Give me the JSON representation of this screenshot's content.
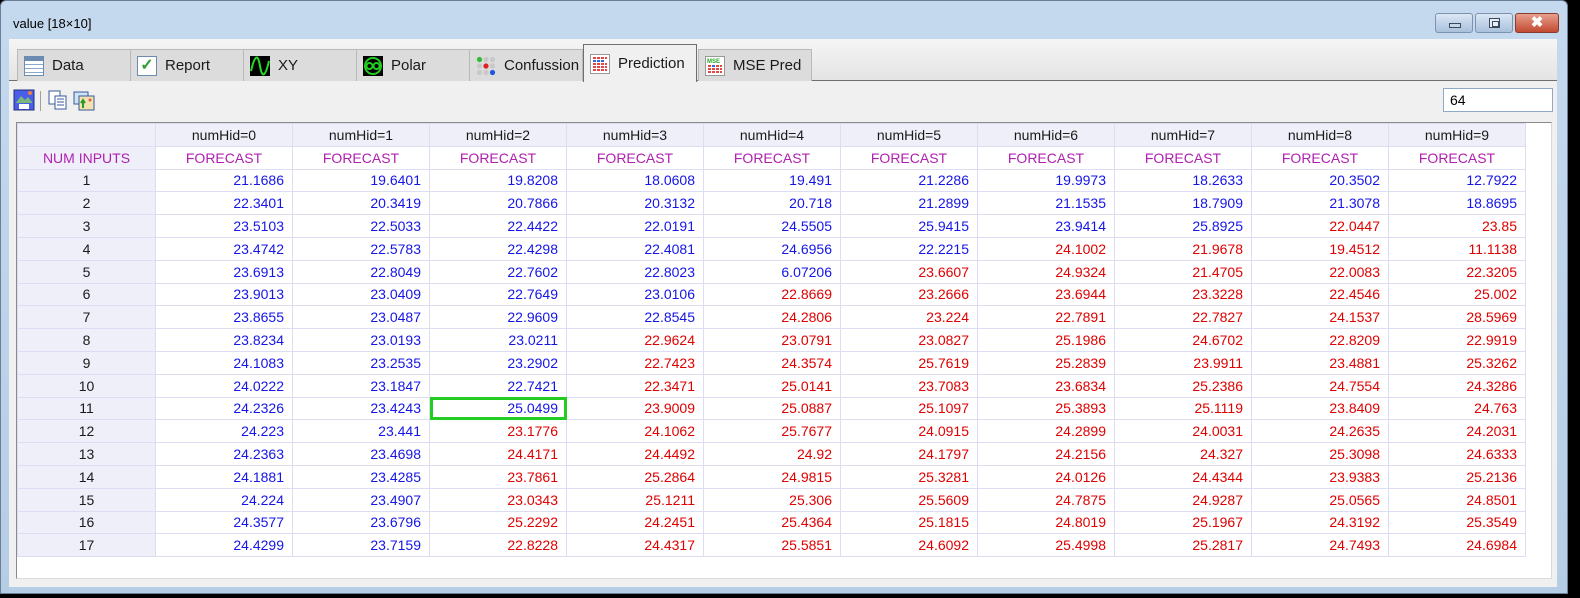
{
  "window": {
    "title": "value [18×10]",
    "controls": {
      "minimize": "minimize",
      "maximize": "maximize",
      "close": "✖"
    }
  },
  "tabs": [
    {
      "label": "Data",
      "icon": "table-icon"
    },
    {
      "label": "Report",
      "icon": "checkbox-icon"
    },
    {
      "label": "XY",
      "icon": "xy-wave-icon"
    },
    {
      "label": "Polar",
      "icon": "polar-icon"
    },
    {
      "label": "Confussion",
      "icon": "confusion-dots-icon"
    },
    {
      "label": "Prediction",
      "icon": "prediction-grid-icon",
      "active": true
    },
    {
      "label": "MSE Pred",
      "icon": "mse-grid-icon"
    }
  ],
  "toolbar": {
    "buttons": [
      "save-image",
      "copy",
      "export-image"
    ],
    "zoom_value": "64"
  },
  "grid": {
    "corner": "",
    "row_header_label": "NUM INPUTS",
    "columns": [
      {
        "header": "numHid=0",
        "sub": "FORECAST"
      },
      {
        "header": "numHid=1",
        "sub": "FORECAST"
      },
      {
        "header": "numHid=2",
        "sub": "FORECAST"
      },
      {
        "header": "numHid=3",
        "sub": "FORECAST"
      },
      {
        "header": "numHid=4",
        "sub": "FORECAST"
      },
      {
        "header": "numHid=5",
        "sub": "FORECAST"
      },
      {
        "header": "numHid=6",
        "sub": "FORECAST"
      },
      {
        "header": "numHid=7",
        "sub": "FORECAST"
      },
      {
        "header": "numHid=8",
        "sub": "FORECAST"
      },
      {
        "header": "numHid=9",
        "sub": "FORECAST"
      }
    ],
    "colors": {
      "good": "#1515e8",
      "bad": "#e00000",
      "selected": "#22cc22"
    },
    "selected": {
      "row": 11,
      "col": 2
    },
    "rows": [
      {
        "label": "1",
        "values": [
          "21.1686",
          "19.6401",
          "19.8208",
          "18.0608",
          "19.491",
          "21.2286",
          "19.9973",
          "18.2633",
          "20.3502",
          "12.7922"
        ],
        "status": [
          "b",
          "b",
          "b",
          "b",
          "b",
          "b",
          "b",
          "b",
          "b",
          "b"
        ]
      },
      {
        "label": "2",
        "values": [
          "22.3401",
          "20.3419",
          "20.7866",
          "20.3132",
          "20.718",
          "21.2899",
          "21.1535",
          "18.7909",
          "21.3078",
          "18.8695"
        ],
        "status": [
          "b",
          "b",
          "b",
          "b",
          "b",
          "b",
          "b",
          "b",
          "b",
          "b"
        ]
      },
      {
        "label": "3",
        "values": [
          "23.5103",
          "22.5033",
          "22.4422",
          "22.0191",
          "24.5505",
          "25.9415",
          "23.9414",
          "25.8925",
          "22.0447",
          "23.85"
        ],
        "status": [
          "b",
          "b",
          "b",
          "b",
          "b",
          "b",
          "b",
          "b",
          "r",
          "r"
        ]
      },
      {
        "label": "4",
        "values": [
          "23.4742",
          "22.5783",
          "22.4298",
          "22.4081",
          "24.6956",
          "22.2215",
          "24.1002",
          "21.9678",
          "19.4512",
          "11.1138"
        ],
        "status": [
          "b",
          "b",
          "b",
          "b",
          "b",
          "b",
          "r",
          "r",
          "r",
          "r"
        ]
      },
      {
        "label": "5",
        "values": [
          "23.6913",
          "22.8049",
          "22.7602",
          "22.8023",
          "6.07206",
          "23.6607",
          "24.9324",
          "21.4705",
          "22.0083",
          "22.3205"
        ],
        "status": [
          "b",
          "b",
          "b",
          "b",
          "b",
          "r",
          "r",
          "r",
          "r",
          "r"
        ]
      },
      {
        "label": "6",
        "values": [
          "23.9013",
          "23.0409",
          "22.7649",
          "23.0106",
          "22.8669",
          "23.2666",
          "23.6944",
          "23.3228",
          "22.4546",
          "25.002"
        ],
        "status": [
          "b",
          "b",
          "b",
          "b",
          "r",
          "r",
          "r",
          "r",
          "r",
          "r"
        ]
      },
      {
        "label": "7",
        "values": [
          "23.8655",
          "23.0487",
          "22.9609",
          "22.8545",
          "24.2806",
          "23.224",
          "22.7891",
          "22.7827",
          "24.1537",
          "28.5969"
        ],
        "status": [
          "b",
          "b",
          "b",
          "b",
          "r",
          "r",
          "r",
          "r",
          "r",
          "r"
        ]
      },
      {
        "label": "8",
        "values": [
          "23.8234",
          "23.0193",
          "23.0211",
          "22.9624",
          "23.0791",
          "23.0827",
          "25.1986",
          "24.6702",
          "22.8209",
          "22.9919"
        ],
        "status": [
          "b",
          "b",
          "b",
          "r",
          "r",
          "r",
          "r",
          "r",
          "r",
          "r"
        ]
      },
      {
        "label": "9",
        "values": [
          "24.1083",
          "23.2535",
          "23.2902",
          "22.7423",
          "24.3574",
          "25.7619",
          "25.2839",
          "23.9911",
          "23.4881",
          "25.3262"
        ],
        "status": [
          "b",
          "b",
          "b",
          "r",
          "r",
          "r",
          "r",
          "r",
          "r",
          "r"
        ]
      },
      {
        "label": "10",
        "values": [
          "24.0222",
          "23.1847",
          "22.7421",
          "22.3471",
          "25.0141",
          "23.7083",
          "23.6834",
          "25.2386",
          "24.7554",
          "24.3286"
        ],
        "status": [
          "b",
          "b",
          "b",
          "r",
          "r",
          "r",
          "r",
          "r",
          "r",
          "r"
        ]
      },
      {
        "label": "11",
        "values": [
          "24.2326",
          "23.4243",
          "25.0499",
          "23.9009",
          "25.0887",
          "25.1097",
          "25.3893",
          "25.1119",
          "23.8409",
          "24.763"
        ],
        "status": [
          "b",
          "b",
          "b",
          "r",
          "r",
          "r",
          "r",
          "r",
          "r",
          "r"
        ]
      },
      {
        "label": "12",
        "values": [
          "24.223",
          "23.441",
          "23.1776",
          "24.1062",
          "25.7677",
          "24.0915",
          "24.2899",
          "24.0031",
          "24.2635",
          "24.2031"
        ],
        "status": [
          "b",
          "b",
          "r",
          "r",
          "r",
          "r",
          "r",
          "r",
          "r",
          "r"
        ]
      },
      {
        "label": "13",
        "values": [
          "24.2363",
          "23.4698",
          "24.4171",
          "24.4492",
          "24.92",
          "24.1797",
          "24.2156",
          "24.327",
          "25.3098",
          "24.6333"
        ],
        "status": [
          "b",
          "b",
          "r",
          "r",
          "r",
          "r",
          "r",
          "r",
          "r",
          "r"
        ]
      },
      {
        "label": "14",
        "values": [
          "24.1881",
          "23.4285",
          "23.7861",
          "25.2864",
          "24.9815",
          "25.3281",
          "24.0126",
          "24.4344",
          "23.9383",
          "25.2136"
        ],
        "status": [
          "b",
          "b",
          "r",
          "r",
          "r",
          "r",
          "r",
          "r",
          "r",
          "r"
        ]
      },
      {
        "label": "15",
        "values": [
          "24.224",
          "23.4907",
          "23.0343",
          "25.1211",
          "25.306",
          "25.5609",
          "24.7875",
          "24.9287",
          "25.0565",
          "24.8501"
        ],
        "status": [
          "b",
          "b",
          "r",
          "r",
          "r",
          "r",
          "r",
          "r",
          "r",
          "r"
        ]
      },
      {
        "label": "16",
        "values": [
          "24.3577",
          "23.6796",
          "25.2292",
          "24.2451",
          "25.4364",
          "25.1815",
          "24.8019",
          "25.1967",
          "24.3192",
          "25.3549"
        ],
        "status": [
          "b",
          "b",
          "r",
          "r",
          "r",
          "r",
          "r",
          "r",
          "r",
          "r"
        ]
      },
      {
        "label": "17",
        "values": [
          "24.4299",
          "23.7159",
          "22.8228",
          "24.4317",
          "25.5851",
          "24.6092",
          "25.4998",
          "25.2817",
          "24.7493",
          "24.6984"
        ],
        "status": [
          "b",
          "b",
          "r",
          "r",
          "r",
          "r",
          "r",
          "r",
          "r",
          "r"
        ]
      }
    ]
  }
}
